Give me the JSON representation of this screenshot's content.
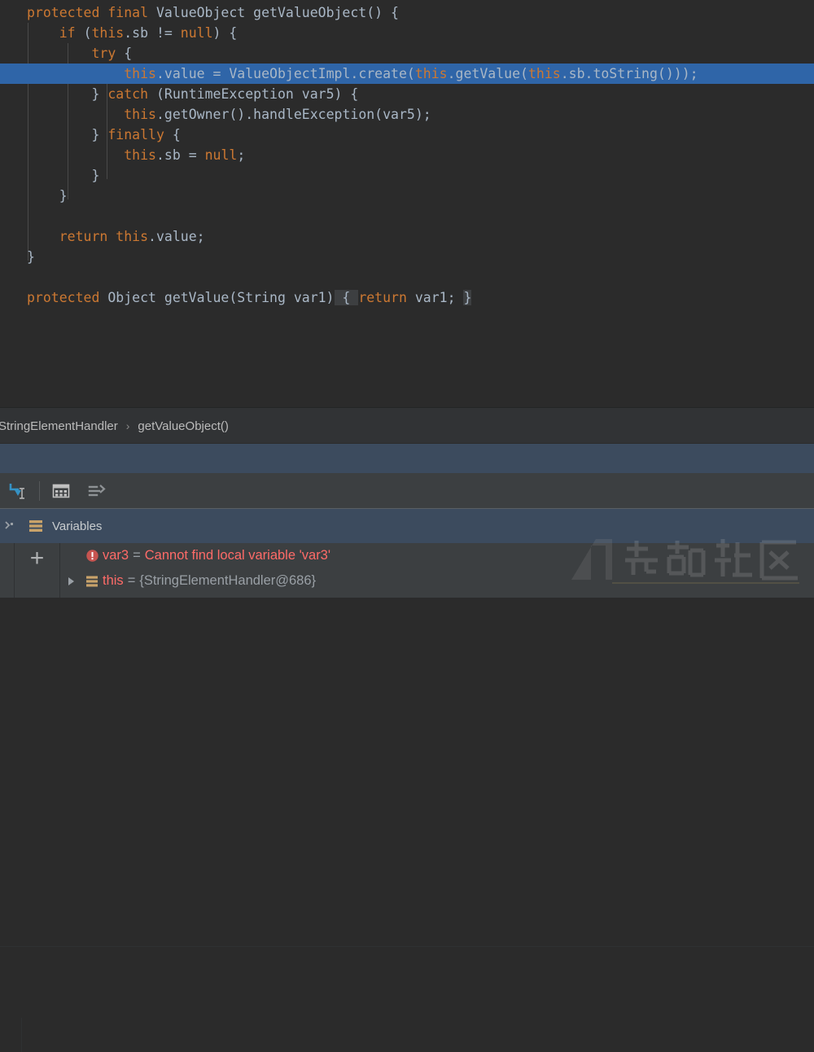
{
  "editor": {
    "lines": [
      {
        "indent": 0,
        "tokens": [
          {
            "t": "protected ",
            "c": "kw"
          },
          {
            "t": "final ",
            "c": "kw"
          },
          {
            "t": "ValueObject getValueObject() {",
            "c": "pl"
          }
        ]
      },
      {
        "indent": 1,
        "tokens": [
          {
            "t": "if ",
            "c": "kw"
          },
          {
            "t": "(",
            "c": "pl"
          },
          {
            "t": "this",
            "c": "kw"
          },
          {
            "t": ".sb != ",
            "c": "pl"
          },
          {
            "t": "null",
            "c": "kw"
          },
          {
            "t": ") {",
            "c": "pl"
          }
        ]
      },
      {
        "indent": 2,
        "tokens": [
          {
            "t": "try",
            "c": "kw"
          },
          {
            "t": " {",
            "c": "pl"
          }
        ]
      },
      {
        "indent": 3,
        "highlight": true,
        "tokens": [
          {
            "t": "this",
            "c": "kw"
          },
          {
            "t": ".value = ValueObjectImpl.create(",
            "c": "pl"
          },
          {
            "t": "this",
            "c": "kw"
          },
          {
            "t": ".getValue(",
            "c": "pl"
          },
          {
            "t": "this",
            "c": "kw"
          },
          {
            "t": ".sb.toString()));",
            "c": "pl"
          }
        ]
      },
      {
        "indent": 2,
        "tokens": [
          {
            "t": "} ",
            "c": "pl"
          },
          {
            "t": "catch ",
            "c": "kw"
          },
          {
            "t": "(RuntimeException var5) {",
            "c": "pl"
          }
        ]
      },
      {
        "indent": 3,
        "tokens": [
          {
            "t": "this",
            "c": "kw"
          },
          {
            "t": ".getOwner().handleException(var5);",
            "c": "pl"
          }
        ]
      },
      {
        "indent": 2,
        "tokens": [
          {
            "t": "} ",
            "c": "pl"
          },
          {
            "t": "finally",
            "c": "kw"
          },
          {
            "t": " {",
            "c": "pl"
          }
        ]
      },
      {
        "indent": 3,
        "tokens": [
          {
            "t": "this",
            "c": "kw"
          },
          {
            "t": ".sb = ",
            "c": "pl"
          },
          {
            "t": "null",
            "c": "kw"
          },
          {
            "t": ";",
            "c": "pl"
          }
        ]
      },
      {
        "indent": 2,
        "tokens": [
          {
            "t": "}",
            "c": "pl"
          }
        ]
      },
      {
        "indent": 1,
        "tokens": [
          {
            "t": "}",
            "c": "pl"
          }
        ]
      },
      {
        "indent": 0,
        "tokens": []
      },
      {
        "indent": 1,
        "tokens": [
          {
            "t": "return ",
            "c": "kw"
          },
          {
            "t": "this",
            "c": "kw"
          },
          {
            "t": ".value;",
            "c": "pl"
          }
        ]
      },
      {
        "indent": 0,
        "tokens": [
          {
            "t": "}",
            "c": "pl"
          }
        ]
      },
      {
        "indent": 0,
        "tokens": []
      },
      {
        "indent": 0,
        "tokens": [
          {
            "t": "protected ",
            "c": "kw"
          },
          {
            "t": "Object getValue(String var1)",
            "c": "pl"
          },
          {
            "t": " { ",
            "c": "fold"
          },
          {
            "t": "return ",
            "c": "kw"
          },
          {
            "t": "var1; ",
            "c": "pl"
          },
          {
            "t": "}",
            "c": "fold"
          }
        ]
      }
    ]
  },
  "breadcrumb": {
    "items": [
      "StringElementHandler",
      "getValueObject()"
    ],
    "separator": "›"
  },
  "debug_toolbar": {
    "buttons": [
      {
        "name": "evaluate-expression-icon",
        "label": "Evaluate Expression"
      },
      {
        "name": "view-as-table-icon",
        "label": "View as Table"
      },
      {
        "name": "sort-values-icon",
        "label": "Sort Values"
      }
    ]
  },
  "variables_panel": {
    "title": "Variables",
    "add_label": "+",
    "rows": [
      {
        "icon": "error-icon",
        "expandable": false,
        "name": "var3",
        "equals": "=",
        "value": "Cannot find local variable 'var3'",
        "value_style": "error"
      },
      {
        "icon": "object-icon",
        "expandable": true,
        "name": "this",
        "equals": "=",
        "value": "{StringElementHandler@686}",
        "value_style": "gray"
      }
    ]
  },
  "watermark": {
    "text": "先知社区"
  },
  "colors": {
    "editor_bg": "#2B2B2B",
    "keyword": "#CC7832",
    "plain": "#A9B7C6",
    "selection": "#2F65A8",
    "panel_bg": "#3C3F41",
    "panel_header": "#3C4B5E",
    "breadcrumb_bg": "#313335",
    "error": "#FF6B68",
    "accent_blue": "#3592C4"
  }
}
